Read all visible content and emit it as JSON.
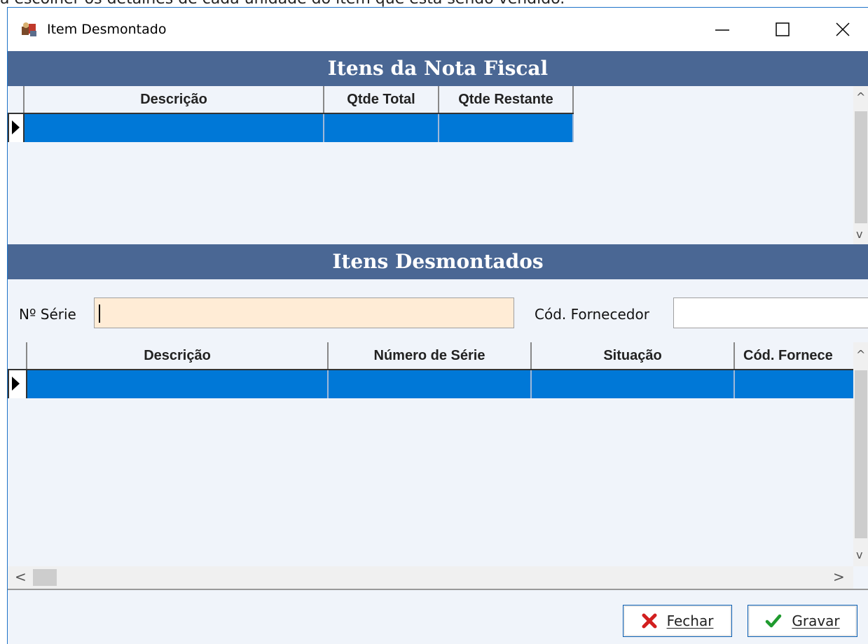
{
  "caption_text": "a escolher os detalhes de cada unidade do item que está sendo vendido.",
  "window": {
    "title": "Item Desmontado"
  },
  "section1": {
    "header": "Itens da Nota Fiscal",
    "columns": [
      "Descrição",
      "Qtde Total",
      "Qtde Restante"
    ]
  },
  "section2": {
    "header": "Itens Desmontados",
    "serie_label": "Nº Série",
    "serie_value": "",
    "fornecedor_label": "Cód. Fornecedor",
    "fornecedor_value": "",
    "columns": [
      "Descrição",
      "Número de Série",
      "Situação",
      "Cód. Fornece"
    ]
  },
  "buttons": {
    "fechar_label": "Fechar",
    "gravar_label": "Gravar"
  },
  "colors": {
    "header_bg": "#4a6794",
    "selected_row": "#0078d7",
    "serie_input_bg": "#ffecd6",
    "panel_bg": "#f0f4fa"
  },
  "icons": {
    "app": "app-icon",
    "minimize": "minimize-icon",
    "maximize": "maximize-icon",
    "close": "close-icon",
    "fechar": "red-x-icon",
    "gravar": "green-check-icon"
  }
}
